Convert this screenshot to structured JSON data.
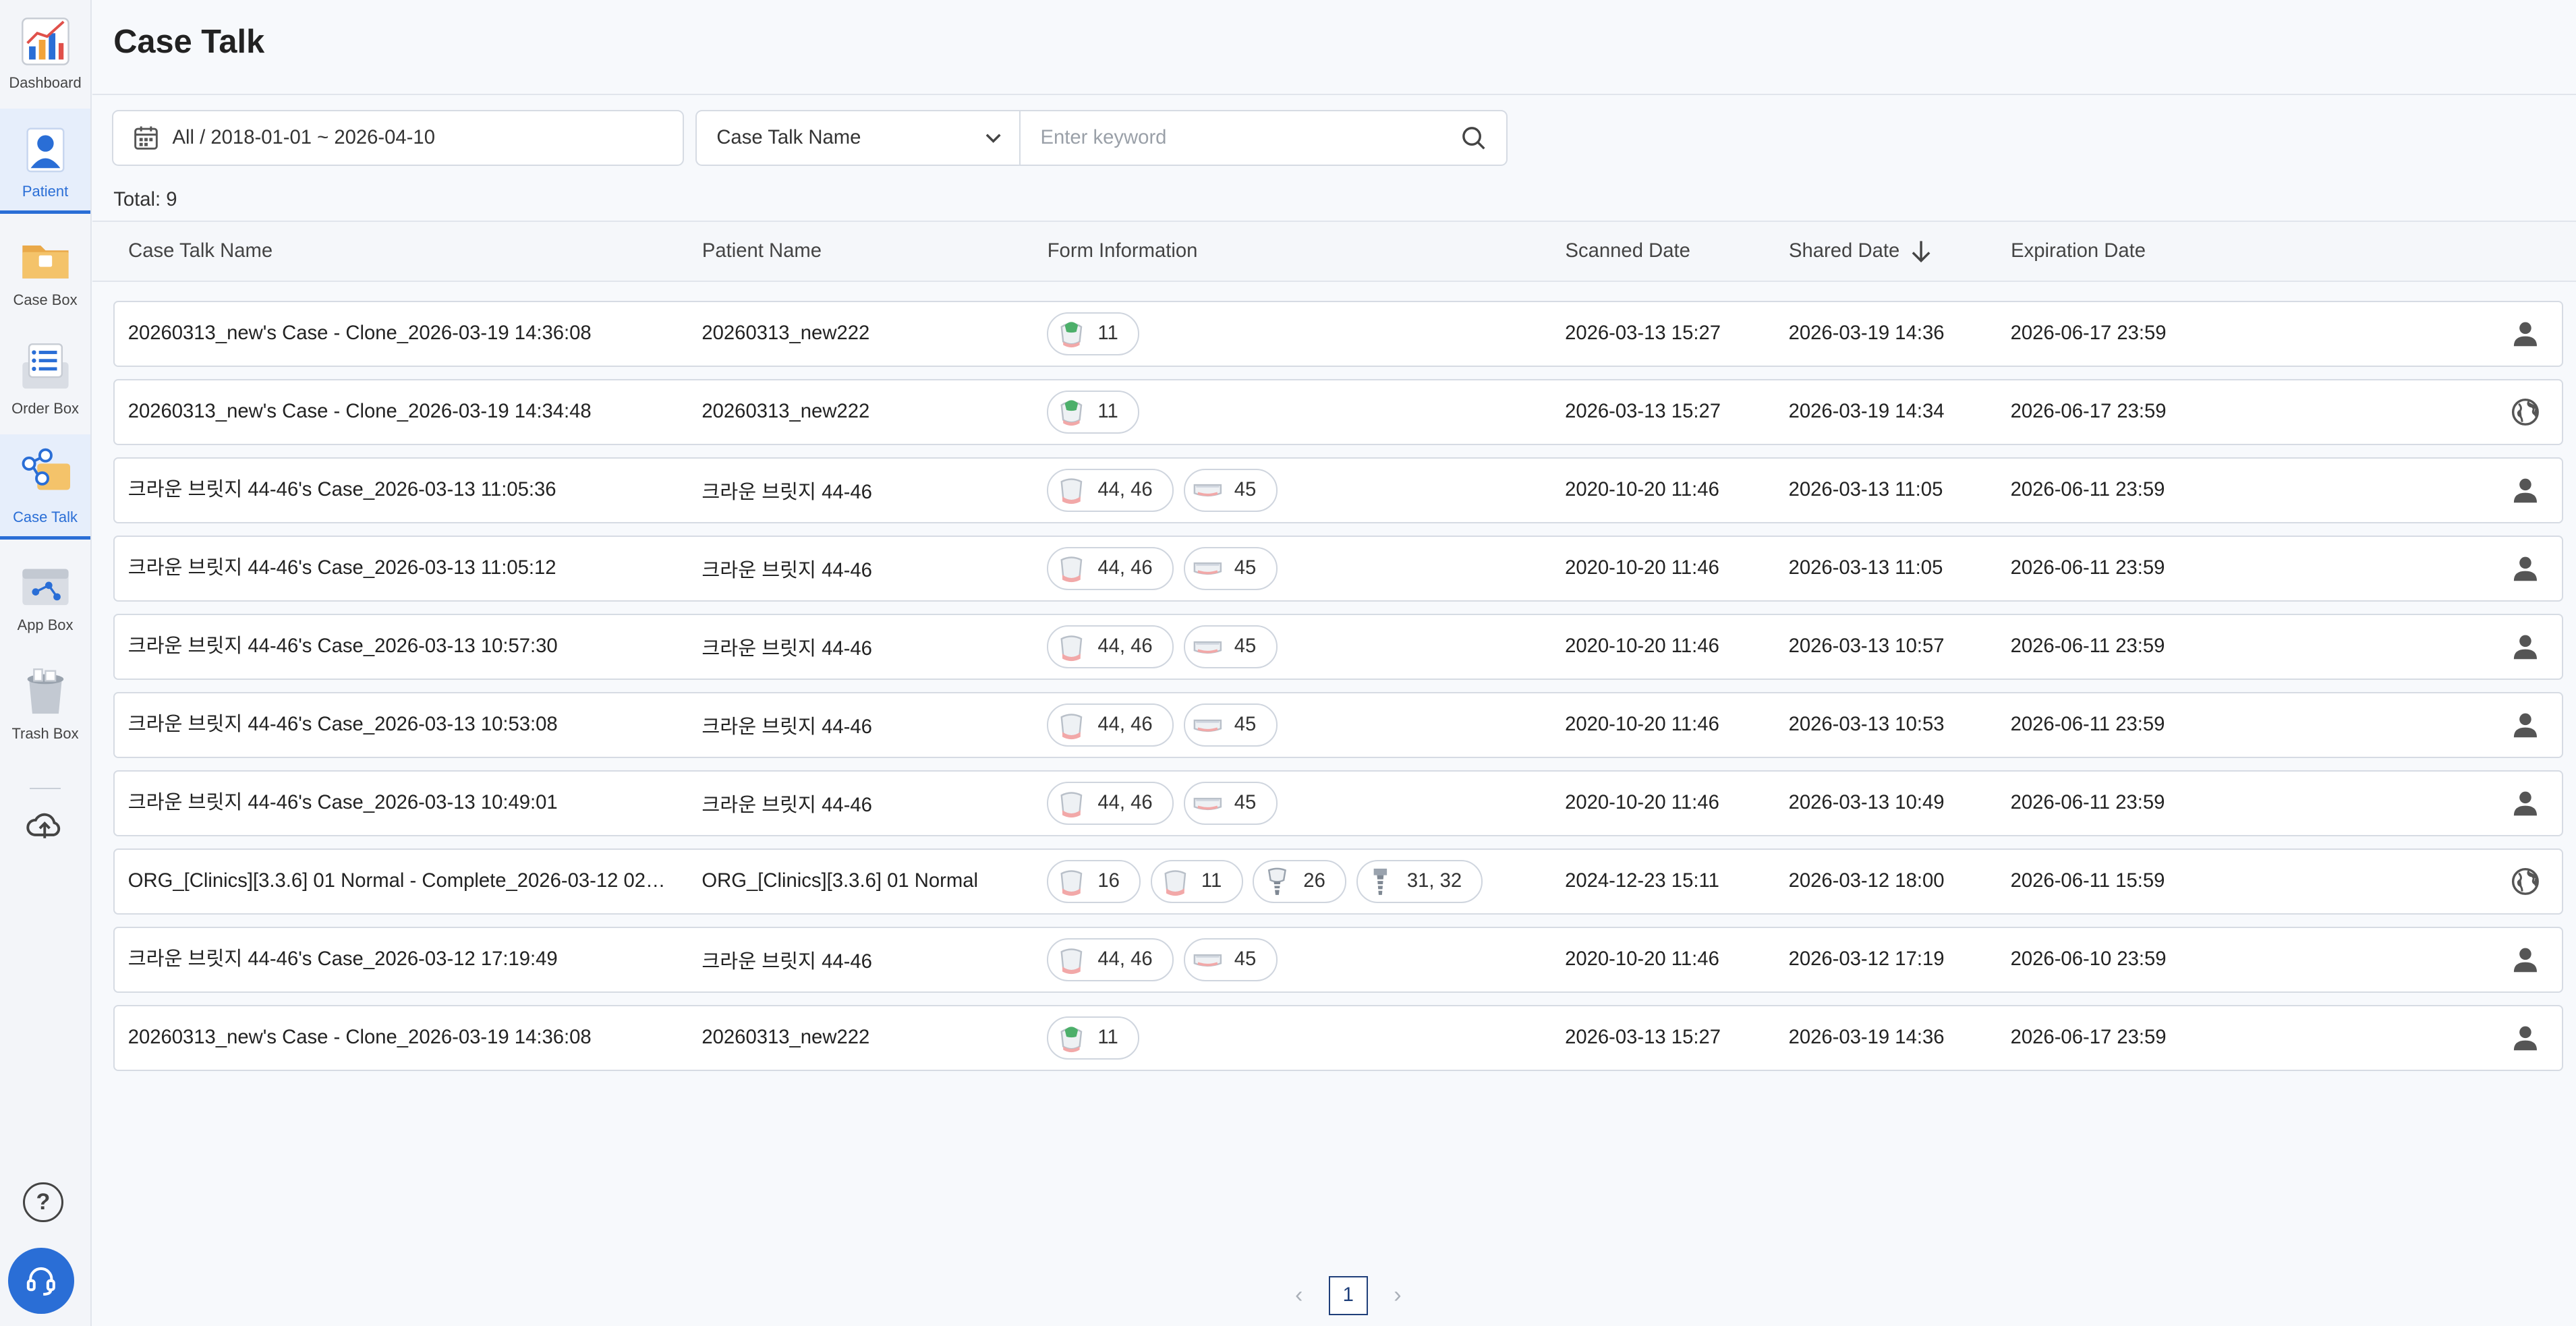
{
  "sidebar": {
    "items": [
      {
        "label": "Dashboard",
        "icon": "dashboard-chart-icon"
      },
      {
        "label": "Patient",
        "icon": "patient-icon",
        "active": true
      },
      {
        "label": "Case Box",
        "icon": "folder-icon"
      },
      {
        "label": "Order Box",
        "icon": "order-list-icon"
      },
      {
        "label": "Case Talk",
        "icon": "share-nodes-icon",
        "active": true
      },
      {
        "label": "App Box",
        "icon": "app-box-icon"
      },
      {
        "label": "Trash Box",
        "icon": "trash-icon"
      }
    ],
    "help": "?"
  },
  "page": {
    "title": "Case Talk"
  },
  "filters": {
    "date_range": "All / 2018-01-01 ~ 2026-04-10",
    "search_field": "Case Talk Name",
    "search_placeholder": "Enter keyword",
    "search_value": ""
  },
  "total": "Total: 9",
  "table": {
    "columns": {
      "name": "Case Talk Name",
      "patient": "Patient Name",
      "form": "Form Information",
      "scanned": "Scanned Date",
      "shared": "Shared Date",
      "expiration": "Expiration Date"
    },
    "rows": [
      {
        "name": "20260313_new's Case - Clone_2026-03-19 14:36:08",
        "patient": "20260313_new222",
        "form": [
          {
            "icon": "crown-green-icon",
            "teeth": "11"
          }
        ],
        "scanned": "2026-03-13 15:27",
        "shared": "2026-03-19 14:36",
        "expiration": "2026-06-17 23:59",
        "share": "person-icon"
      },
      {
        "name": "20260313_new's Case - Clone_2026-03-19 14:34:48",
        "patient": "20260313_new222",
        "form": [
          {
            "icon": "crown-green-icon",
            "teeth": "11"
          }
        ],
        "scanned": "2026-03-13 15:27",
        "shared": "2026-03-19 14:34",
        "expiration": "2026-06-17 23:59",
        "share": "globe-icon"
      },
      {
        "name": "크라운 브릿지 44-46's Case_2026-03-13 11:05:36",
        "patient": "크라운 브릿지 44-46",
        "form": [
          {
            "icon": "crown-icon",
            "teeth": "44, 46"
          },
          {
            "icon": "pontic-icon",
            "teeth": "45"
          }
        ],
        "scanned": "2020-10-20 11:46",
        "shared": "2026-03-13 11:05",
        "expiration": "2026-06-11 23:59",
        "share": "person-icon"
      },
      {
        "name": "크라운 브릿지 44-46's Case_2026-03-13 11:05:12",
        "patient": "크라운 브릿지 44-46",
        "form": [
          {
            "icon": "crown-icon",
            "teeth": "44, 46"
          },
          {
            "icon": "pontic-icon",
            "teeth": "45"
          }
        ],
        "scanned": "2020-10-20 11:46",
        "shared": "2026-03-13 11:05",
        "expiration": "2026-06-11 23:59",
        "share": "person-icon"
      },
      {
        "name": "크라운 브릿지 44-46's Case_2026-03-13 10:57:30",
        "patient": "크라운 브릿지 44-46",
        "form": [
          {
            "icon": "crown-icon",
            "teeth": "44, 46"
          },
          {
            "icon": "pontic-icon",
            "teeth": "45"
          }
        ],
        "scanned": "2020-10-20 11:46",
        "shared": "2026-03-13 10:57",
        "expiration": "2026-06-11 23:59",
        "share": "person-icon"
      },
      {
        "name": "크라운 브릿지 44-46's Case_2026-03-13 10:53:08",
        "patient": "크라운 브릿지 44-46",
        "form": [
          {
            "icon": "crown-icon",
            "teeth": "44, 46"
          },
          {
            "icon": "pontic-icon",
            "teeth": "45"
          }
        ],
        "scanned": "2020-10-20 11:46",
        "shared": "2026-03-13 10:53",
        "expiration": "2026-06-11 23:59",
        "share": "person-icon"
      },
      {
        "name": "크라운 브릿지 44-46's Case_2026-03-13 10:49:01",
        "patient": "크라운 브릿지 44-46",
        "form": [
          {
            "icon": "crown-icon",
            "teeth": "44, 46"
          },
          {
            "icon": "pontic-icon",
            "teeth": "45"
          }
        ],
        "scanned": "2020-10-20 11:46",
        "shared": "2026-03-13 10:49",
        "expiration": "2026-06-11 23:59",
        "share": "person-icon"
      },
      {
        "name": "ORG_[Clinics][3.3.6] 01 Normal - Complete_2026-03-12 02:0...",
        "patient": "ORG_[Clinics][3.3.6] 01 Normal",
        "form": [
          {
            "icon": "crown-icon",
            "teeth": "16"
          },
          {
            "icon": "crown-icon",
            "teeth": "11"
          },
          {
            "icon": "implant-crown-icon",
            "teeth": "26"
          },
          {
            "icon": "implant-icon",
            "teeth": "31, 32"
          }
        ],
        "scanned": "2024-12-23 15:11",
        "shared": "2026-03-12 18:00",
        "expiration": "2026-06-11 15:59",
        "share": "globe-icon"
      },
      {
        "name": "크라운 브릿지 44-46's Case_2026-03-12 17:19:49",
        "patient": "크라운 브릿지 44-46",
        "form": [
          {
            "icon": "crown-icon",
            "teeth": "44, 46"
          },
          {
            "icon": "pontic-icon",
            "teeth": "45"
          }
        ],
        "scanned": "2020-10-20 11:46",
        "shared": "2026-03-12 17:19",
        "expiration": "2026-06-10 23:59",
        "share": "person-icon"
      },
      {
        "name": "20260313_new's Case - Clone_2026-03-19 14:36:08",
        "patient": "20260313_new222",
        "form": [
          {
            "icon": "crown-green-icon",
            "teeth": "11"
          }
        ],
        "scanned": "2026-03-13 15:27",
        "shared": "2026-03-19 14:36",
        "expiration": "2026-06-17 23:59",
        "share": "person-icon"
      }
    ]
  },
  "pagination": {
    "current": "1",
    "prev": "‹",
    "next": "›"
  },
  "colors": {
    "accent": "#2a6ed6"
  }
}
